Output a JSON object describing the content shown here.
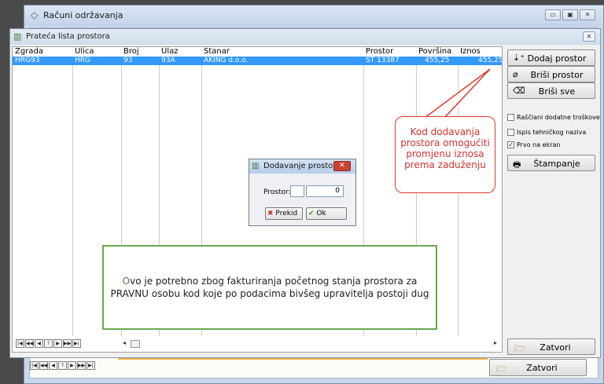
{
  "outer": {
    "title": "Računi održavanja",
    "min": "▭",
    "max": "▣",
    "close": "✕"
  },
  "inner": {
    "title": "Prateća lista prostora",
    "close": "✕"
  },
  "grid": {
    "columns": [
      "Zgrada",
      "Ulica",
      "Broj",
      "Ulaz",
      "Stanar",
      "Prostor",
      "Površina",
      "Iznos"
    ],
    "rows": [
      {
        "zgrada": "HRG93",
        "ulica": "HRG",
        "broj": "93",
        "ulaz": "93A",
        "stanar": "AKING d.o.o.",
        "prostor": "ST 13387",
        "povrsina": "455,25",
        "iznos": "455,25"
      }
    ]
  },
  "nav": {
    "first": "|◀",
    "prev_page": "◀◀",
    "prev": "◀",
    "q": "?",
    "next": "▶",
    "next_page": "▶▶",
    "last": "▶|"
  },
  "side": {
    "dodaj": "Dodaj prostor",
    "brisi": "Briši prostor",
    "brisi_sve": "Briši sve",
    "chk1": "Raščlani dodatne troškove",
    "chk2": "Ispis tehničkog naziva",
    "chk3": "Prvo na ekran",
    "stampanje": "Štampanje",
    "zatvori": "Zatvori"
  },
  "callout_red": {
    "text": "Kod dodavanja prostora omogućiti promjenu iznosa prema zaduženju"
  },
  "dialog": {
    "title": "Dodavanje prostora",
    "label": "Prostor:",
    "value": "0",
    "cancel": "Prekid",
    "ok": "Ok"
  },
  "callout_green": {
    "first": "O",
    "text": "vo je potrebno zbog fakturiranja početnog stanja prostora za PRAVNU osobu kod koje po podacima bivšeg upravitelja postoji dug"
  },
  "outer_bottom": {
    "zatvori": "Zatvori"
  },
  "colors": {
    "selection": "#3399ff",
    "callout_red": "#e03a2c",
    "callout_green": "#6aa84f"
  }
}
